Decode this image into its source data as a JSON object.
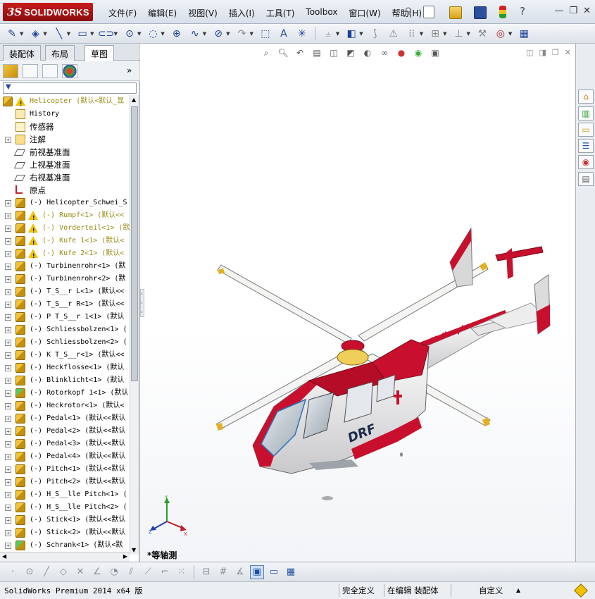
{
  "app": {
    "logo_prefix": "3S",
    "logo_brand": "SOLIDWORKS"
  },
  "menu": [
    "文件(F)",
    "编辑(E)",
    "视图(V)",
    "插入(I)",
    "工具(T)",
    "Toolbox",
    "窗口(W)",
    "帮助(H)"
  ],
  "panel_tabs": [
    "装配体",
    "布局",
    "草图"
  ],
  "active_tab": "草图",
  "tree": [
    {
      "label": "Helicopter  (默认<默认_显",
      "icon": "assembly-icon",
      "warn": true,
      "style": "yellow",
      "expand": "",
      "level": 0
    },
    {
      "label": "History",
      "icon": "history-icon",
      "warn": false,
      "style": "",
      "expand": "",
      "level": 1
    },
    {
      "label": "传感器",
      "icon": "sensor-icon",
      "warn": false,
      "style": "cjk",
      "expand": "",
      "level": 1
    },
    {
      "label": "注解",
      "icon": "annotation-icon",
      "warn": false,
      "style": "cjk",
      "expand": "+",
      "level": 1
    },
    {
      "label": "前视基准面",
      "icon": "plane-icon",
      "warn": false,
      "style": "cjk",
      "expand": "",
      "level": 1
    },
    {
      "label": "上视基准面",
      "icon": "plane-icon",
      "warn": false,
      "style": "cjk",
      "expand": "",
      "level": 1
    },
    {
      "label": "右视基准面",
      "icon": "plane-icon",
      "warn": false,
      "style": "cjk",
      "expand": "",
      "level": 1
    },
    {
      "label": "原点",
      "icon": "origin-icon",
      "warn": false,
      "style": "cjk",
      "expand": "",
      "level": 1
    },
    {
      "label": "(-) Helicopter_Schwei_S",
      "icon": "part-icon",
      "warn": false,
      "style": "",
      "expand": "+",
      "level": 1
    },
    {
      "label": "(-) Rumpf<1> (默认<<",
      "icon": "part-icon",
      "warn": true,
      "style": "yellow",
      "expand": "+",
      "level": 1
    },
    {
      "label": "(-) Vorderteil<1> (默",
      "icon": "part-icon",
      "warn": true,
      "style": "yellow",
      "expand": "+",
      "level": 1
    },
    {
      "label": "(-) Kufe 1<1> (默认<",
      "icon": "part-icon",
      "warn": true,
      "style": "yellow",
      "expand": "+",
      "level": 1
    },
    {
      "label": "(-) Kufe 2<1> (默认<",
      "icon": "part-icon",
      "warn": true,
      "style": "yellow",
      "expand": "+",
      "level": 1
    },
    {
      "label": "(-) Turbinenrohr<1> (默",
      "icon": "part-icon",
      "warn": false,
      "style": "",
      "expand": "+",
      "level": 1
    },
    {
      "label": "(-) Turbinenrohr<2> (默",
      "icon": "part-icon",
      "warn": false,
      "style": "",
      "expand": "+",
      "level": 1
    },
    {
      "label": "(-) T_S__r L<1> (默认<<",
      "icon": "part-icon",
      "warn": false,
      "style": "",
      "expand": "+",
      "level": 1
    },
    {
      "label": "(-) T_S__r R<1> (默认<<",
      "icon": "part-icon",
      "warn": false,
      "style": "",
      "expand": "+",
      "level": 1
    },
    {
      "label": "(-) P T_S__r 1<1> (默认",
      "icon": "part-icon",
      "warn": false,
      "style": "",
      "expand": "+",
      "level": 1
    },
    {
      "label": "(-) Schliessbolzen<1> (",
      "icon": "part-icon",
      "warn": false,
      "style": "",
      "expand": "+",
      "level": 1
    },
    {
      "label": "(-) Schliessbolzen<2> (",
      "icon": "part-icon",
      "warn": false,
      "style": "",
      "expand": "+",
      "level": 1
    },
    {
      "label": "(-) K T_S__r<1> (默认<<",
      "icon": "part-icon",
      "warn": false,
      "style": "",
      "expand": "+",
      "level": 1
    },
    {
      "label": "(-) Heckflosse<1> (默认",
      "icon": "part-icon",
      "warn": false,
      "style": "",
      "expand": "+",
      "level": 1
    },
    {
      "label": "(-) Blinklicht<1> (默认",
      "icon": "part-icon",
      "warn": false,
      "style": "",
      "expand": "+",
      "level": 1
    },
    {
      "label": "(-) Rotorkopf 1<1> (默认",
      "icon": "subassembly-icon",
      "warn": false,
      "style": "",
      "expand": "+",
      "level": 1
    },
    {
      "label": "(-) Heckrotor<1> (默认<",
      "icon": "part-icon",
      "warn": false,
      "style": "",
      "expand": "+",
      "level": 1
    },
    {
      "label": "(-) Pedal<1> (默认<<默认",
      "icon": "part-icon",
      "warn": false,
      "style": "",
      "expand": "+",
      "level": 1
    },
    {
      "label": "(-) Pedal<2> (默认<<默认",
      "icon": "part-icon",
      "warn": false,
      "style": "",
      "expand": "+",
      "level": 1
    },
    {
      "label": "(-) Pedal<3> (默认<<默认",
      "icon": "part-icon",
      "warn": false,
      "style": "",
      "expand": "+",
      "level": 1
    },
    {
      "label": "(-) Pedal<4> (默认<<默认",
      "icon": "part-icon",
      "warn": false,
      "style": "",
      "expand": "+",
      "level": 1
    },
    {
      "label": "(-) Pitch<1> (默认<<默认",
      "icon": "part-icon",
      "warn": false,
      "style": "",
      "expand": "+",
      "level": 1
    },
    {
      "label": "(-) Pitch<2> (默认<<默认",
      "icon": "part-icon",
      "warn": false,
      "style": "",
      "expand": "+",
      "level": 1
    },
    {
      "label": "(-) H_S__lle Pitch<1> (",
      "icon": "part-icon",
      "warn": false,
      "style": "",
      "expand": "+",
      "level": 1
    },
    {
      "label": "(-) H_S__lle Pitch<2> (",
      "icon": "part-icon",
      "warn": false,
      "style": "",
      "expand": "+",
      "level": 1
    },
    {
      "label": "(-) Stick<1> (默认<<默认",
      "icon": "part-icon",
      "warn": false,
      "style": "",
      "expand": "+",
      "level": 1
    },
    {
      "label": "(-) Stick<2> (默认<<默认",
      "icon": "part-icon",
      "warn": false,
      "style": "",
      "expand": "+",
      "level": 1
    },
    {
      "label": "(-) Schrank<1> (默认<默",
      "icon": "subassembly-icon",
      "warn": false,
      "style": "",
      "expand": "+",
      "level": 1
    }
  ],
  "graphics": {
    "view_orientation_label": "*等轴测",
    "triad_labels": {
      "x": "X",
      "y": "Y",
      "z": "Z"
    },
    "model_text": {
      "brand": "DRF",
      "tail": "Helicopter"
    }
  },
  "status": {
    "product": "SolidWorks Premium 2014 x64 版",
    "cells": [
      "完全定义",
      "在编辑 装配体",
      "自定义"
    ]
  },
  "colors": {
    "accent_red": "#c81c1c",
    "helicopter_red": "#c8102e",
    "helicopter_white": "#f2f2f2"
  }
}
